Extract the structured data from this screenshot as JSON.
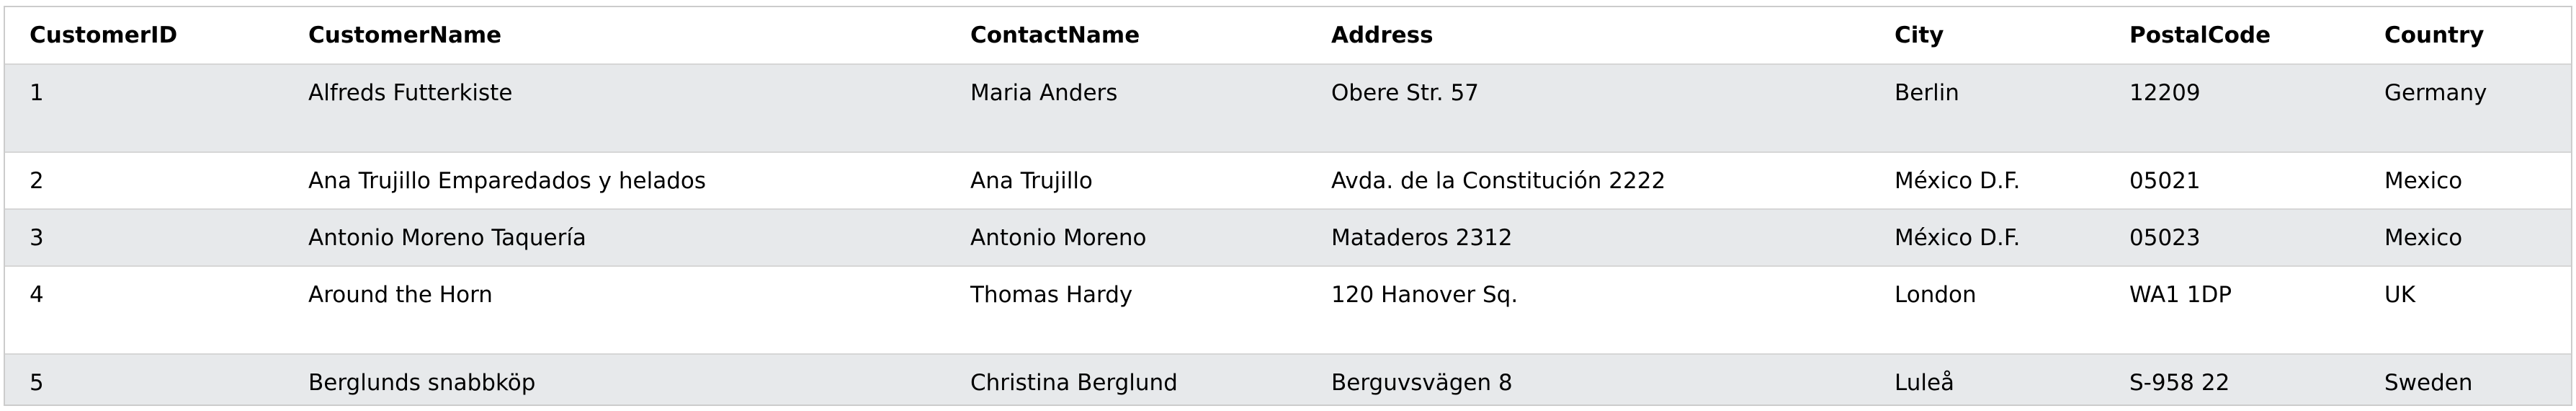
{
  "table": {
    "columns": [
      "CustomerID",
      "CustomerName",
      "ContactName",
      "Address",
      "City",
      "PostalCode",
      "Country"
    ],
    "rows": [
      [
        "1",
        "Alfreds Futterkiste",
        "Maria Anders",
        "Obere Str. 57",
        "Berlin",
        "12209",
        "Germany"
      ],
      [
        "2",
        "Ana Trujillo Emparedados y helados",
        "Ana Trujillo",
        "Avda. de la Constitución 2222",
        "México D.F.",
        "05021",
        "Mexico"
      ],
      [
        "3",
        "Antonio Moreno Taquería",
        "Antonio Moreno",
        "Mataderos 2312",
        "México D.F.",
        "05023",
        "Mexico"
      ],
      [
        "4",
        "Around the Horn",
        "Thomas Hardy",
        "120 Hanover Sq.",
        "London",
        "WA1 1DP",
        "UK"
      ],
      [
        "5",
        "Berglunds snabbköp",
        "Christina Berglund",
        "Berguvsvägen 8",
        "Luleå",
        "S-958 22",
        "Sweden"
      ]
    ]
  },
  "colors": {
    "row_shade": "#e7e9eb",
    "row_plain": "#ffffff",
    "border": "#cccccc"
  }
}
